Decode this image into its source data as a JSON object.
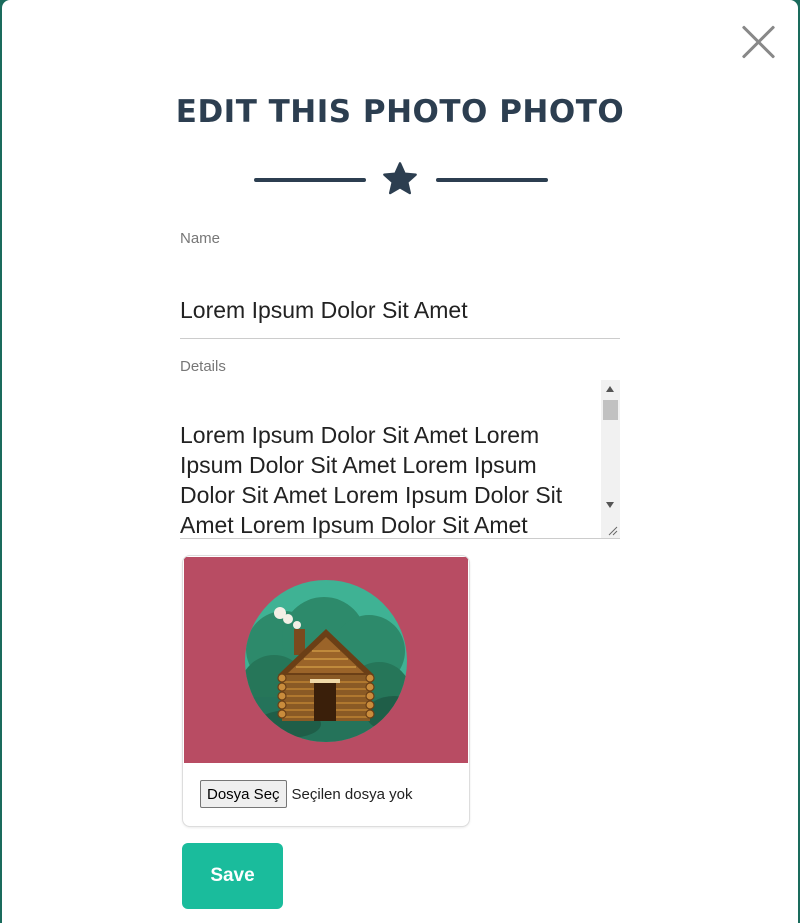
{
  "modal": {
    "title": "EDIT THIS PHOTO PHOTO",
    "close_icon": "close-icon",
    "divider_icon": "star-icon"
  },
  "form": {
    "name": {
      "label": "Name",
      "value": "Lorem Ipsum Dolor Sit Amet"
    },
    "details": {
      "label": "Details",
      "value": "Lorem Ipsum Dolor Sit Amet Lorem Ipsum Dolor Sit Amet Lorem Ipsum Dolor Sit Amet Lorem Ipsum Dolor Sit Amet Lorem Ipsum Dolor Sit Amet"
    },
    "image": {
      "preview_icon": "log-cabin-icon",
      "file_button_label": "Dosya Seç",
      "file_status": "Seçilen dosya yok"
    },
    "save_label": "Save"
  },
  "colors": {
    "title": "#2c3e50",
    "accent": "#1abc9c",
    "image_background": "#b84c63",
    "backdrop": "#1a6b5c"
  }
}
